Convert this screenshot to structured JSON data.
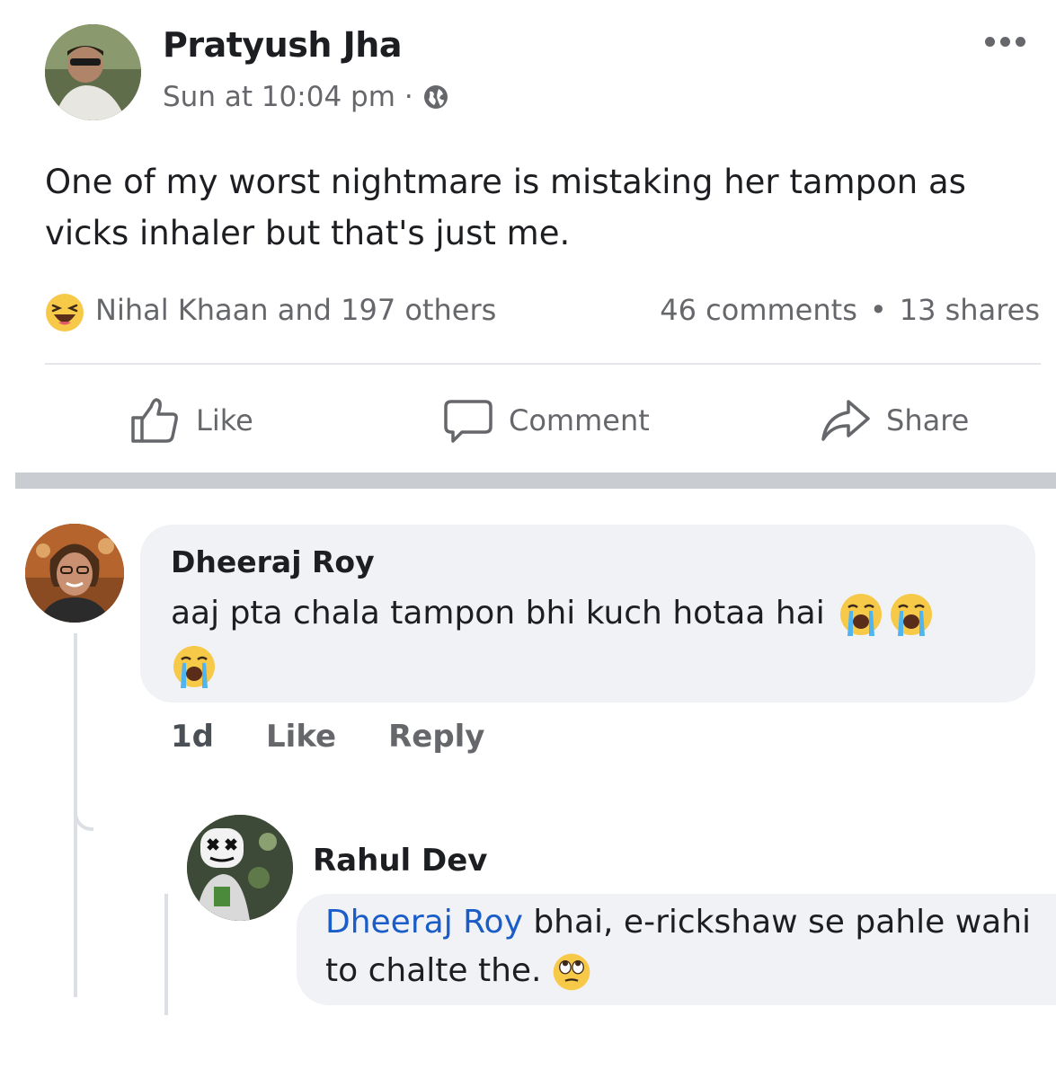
{
  "post": {
    "author": "Pratyush Jha",
    "time": "Sun at 10:04 pm",
    "meta_separator": "·",
    "text": "One of my worst nightmare is mistaking her tampon as vicks inhaler but that's just me.",
    "reactions_text": "Nihal Khaan and 197 others",
    "reaction_emoji": "haha-emoji-icon",
    "comments_count": "46 comments",
    "stats_separator": "•",
    "shares_count": "13 shares"
  },
  "actions": {
    "like": "Like",
    "comment": "Comment",
    "share": "Share"
  },
  "comment": {
    "author": "Dheeraj Roy",
    "text": "aaj pta chala tampon bhi kuch hotaa hai",
    "emojis": [
      "crying-face-emoji",
      "crying-face-emoji",
      "crying-face-emoji"
    ],
    "time": "1d",
    "like_label": "Like",
    "reply_label": "Reply"
  },
  "reply": {
    "author": "Rahul Dev",
    "mention": "Dheeraj Roy",
    "text": " bhai, e-rickshaw se pahle wahi to chalte the.",
    "emoji": "eye-roll-emoji"
  },
  "colors": {
    "mention": "#1a5cc8",
    "secondary_text": "#65676b",
    "bubble": "#f0f2f5"
  }
}
